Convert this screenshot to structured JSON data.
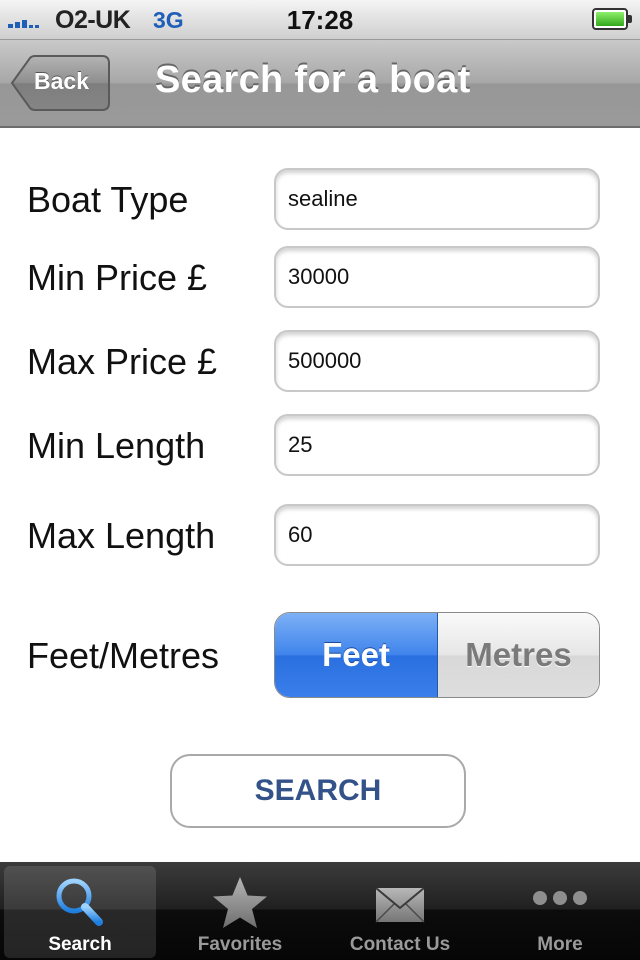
{
  "status_bar": {
    "carrier": "O2-UK",
    "network": "3G",
    "time": "17:28"
  },
  "nav": {
    "back_label": "Back",
    "title": "Search for a boat"
  },
  "form": {
    "fields": [
      {
        "label": "Boat Type",
        "value": "sealine"
      },
      {
        "label": "Min Price £",
        "value": "30000"
      },
      {
        "label": "Max Price £",
        "value": "500000"
      },
      {
        "label": "Min Length",
        "value": "25"
      },
      {
        "label": "Max Length",
        "value": "60"
      }
    ],
    "units": {
      "label": "Feet/Metres",
      "options": [
        "Feet",
        "Metres"
      ],
      "selected": "Feet"
    },
    "search_label": "SEARCH"
  },
  "tabs": [
    {
      "label": "Search",
      "icon": "magnifier-icon",
      "active": true
    },
    {
      "label": "Favorites",
      "icon": "star-icon",
      "active": false
    },
    {
      "label": "Contact Us",
      "icon": "envelope-icon",
      "active": false
    },
    {
      "label": "More",
      "icon": "more-dots-icon",
      "active": false
    }
  ],
  "colors": {
    "accent": "#3f84ec",
    "button_text": "#34528a",
    "network": "#1f5fb8"
  }
}
